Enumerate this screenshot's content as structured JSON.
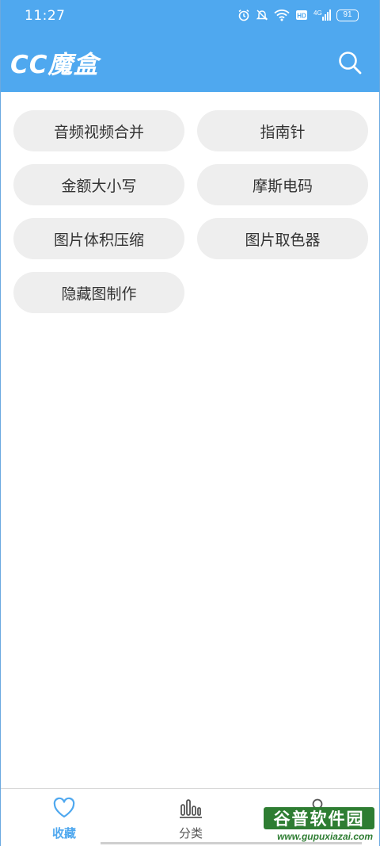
{
  "status_bar": {
    "time": "11:27",
    "battery": "91",
    "icons": [
      "alarm-icon",
      "mute-icon",
      "wifi-icon",
      "hd-icon",
      "signal-4g-icon",
      "battery-icon"
    ]
  },
  "header": {
    "title": "CC魔盒",
    "background": "#4fa8ef"
  },
  "tools": [
    {
      "label": "音频视频合并"
    },
    {
      "label": "指南针"
    },
    {
      "label": "金额大小写"
    },
    {
      "label": "摩斯电码"
    },
    {
      "label": "图片体积压缩"
    },
    {
      "label": "图片取色器"
    },
    {
      "label": "隐藏图制作"
    }
  ],
  "bottom_nav": {
    "items": [
      {
        "label": "收藏",
        "icon": "heart-icon",
        "active": true
      },
      {
        "label": "分类",
        "icon": "bar-chart-icon",
        "active": false
      },
      {
        "label": "",
        "icon": "user-icon",
        "active": false
      }
    ]
  },
  "watermark": {
    "name": "谷普软件园",
    "url": "www.gupuxiazai.com"
  },
  "colors": {
    "accent": "#4fa8ef",
    "button_bg": "#eeeeee",
    "watermark": "#2e7d32"
  }
}
